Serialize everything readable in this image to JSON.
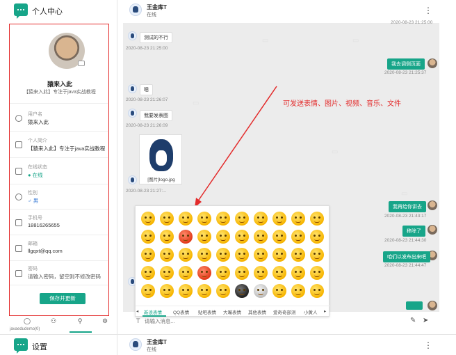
{
  "left_header": {
    "title": "个人中心",
    "icon": "chat-logo-icon"
  },
  "profile": {
    "name": "猿来入此",
    "subtitle": "【猿来入此】专注于java实战教程",
    "fields": [
      {
        "label": "用户名",
        "value": "猿来入此",
        "icon": "user-icon"
      },
      {
        "label": "个人简介",
        "value": "【猿来入此】专注于java实战教程",
        "icon": "edit-icon"
      },
      {
        "label": "在线状态",
        "value": "● 在线",
        "icon": "message-icon"
      },
      {
        "label": "性别",
        "value": "♂ 男",
        "icon": "person-icon"
      },
      {
        "label": "手机号",
        "value": "18816265655",
        "icon": "phone-icon"
      },
      {
        "label": "邮箱",
        "value": "llgqxt@qq.com",
        "icon": "mail-icon"
      },
      {
        "label": "密码",
        "value": "请输入密码，留空则不修改密码",
        "icon": "lock-icon"
      }
    ],
    "save_label": "保存并更新"
  },
  "bottom_nav": {
    "footer_id": "javaedudemo(0)"
  },
  "chat_header": {
    "name": "王金库T",
    "status": "在线"
  },
  "messages": [
    {
      "text": "测试的不行",
      "time": "2020-08-23 21:25:00",
      "side": "left"
    },
    {
      "text": "我去调侧页面",
      "time": "2020-08-23 21:25:37",
      "side": "right"
    },
    {
      "text": "嗯",
      "time": "2020-08-23 21:26:07",
      "side": "left"
    },
    {
      "text": "我要发表图",
      "time": "2020-08-23 21:26:09",
      "side": "left"
    },
    {
      "image_caption": "[图片]logo.jpg",
      "time": "2020-08-23 21:27:...",
      "side": "left"
    },
    {
      "text": "我再给你讲去",
      "time": "2020-08-23 21:43:17",
      "side": "right"
    },
    {
      "text": "移除了",
      "time": "2020-08-23 21:44:30",
      "side": "right"
    },
    {
      "text": "咱们以发布出来吧",
      "time": "2020-08-23 21:44:47",
      "side": "right"
    }
  ],
  "top_timestamp": "2020-08-23 21:25:00",
  "annotation": "可发送表情、图片、视频、音乐、文件",
  "emoji_tabs": [
    "新浪表情",
    "QQ表情",
    "贴吧表情",
    "大嘴表情",
    "其他表情",
    "爱奇奇部测",
    "小黄人"
  ],
  "input": {
    "placeholder": "请输入消息..."
  },
  "second_left_header": {
    "title": "设置"
  },
  "second_chat_header": {
    "name": "王金库T",
    "status": "在线"
  }
}
